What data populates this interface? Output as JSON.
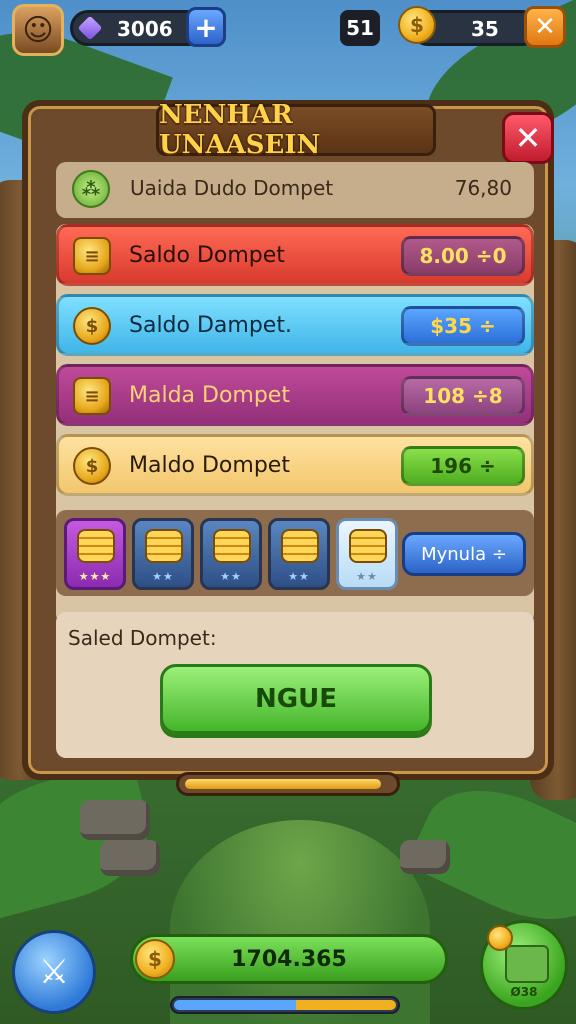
{
  "topbar": {
    "gems": "3006",
    "plus_label": "+",
    "level": "51",
    "coins": "35",
    "close_label": "✕"
  },
  "panel": {
    "title": "NENHAR UNAASEIN",
    "close_label": "✕",
    "summary": {
      "label": "Uaida Dudo Dompet",
      "value": "76,80"
    },
    "rows": [
      {
        "label": "Saldo Dompet",
        "value": "8.00 ÷0",
        "icon": "coin-stack-icon"
      },
      {
        "label": "Saldo Dampet.",
        "value": "$35 ÷",
        "icon": "coin-icon"
      },
      {
        "label": "Malda Dompet",
        "value": "108 ÷8",
        "icon": "coin-stack-icon"
      },
      {
        "label": "Maldo Dompet",
        "value": "196 ÷",
        "icon": "coin-icon"
      }
    ],
    "items": [
      {
        "stars": "★★★",
        "selected": true
      },
      {
        "stars": "★★"
      },
      {
        "stars": "★★"
      },
      {
        "stars": "★★"
      },
      {
        "stars": "★★"
      }
    ],
    "mynula_label": "Mynula ÷",
    "bottom_label": "Saled Dompet:",
    "cta_label": "NGUE",
    "progress": 0.95
  },
  "hud": {
    "balance": "1704.365",
    "right_label": "Ø38",
    "xp_progress": 0.55
  },
  "colors": {
    "accent": "#45b52a",
    "panel": "#6e4a2c",
    "title": "#ffd24a"
  }
}
